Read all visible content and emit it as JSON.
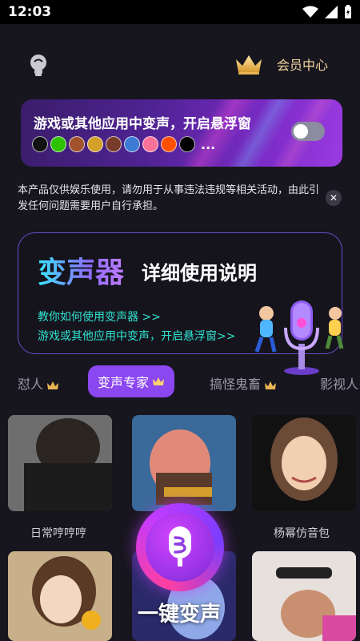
{
  "status": {
    "time": "12:03"
  },
  "header": {
    "vip_label": "会员中心",
    "colors": {
      "gold": "#f4d7a0"
    }
  },
  "float_card": {
    "title": "游戏或其他应用中变声，开启悬浮窗",
    "toggle_on": false,
    "more": "...",
    "app_icons": [
      "qq-icon",
      "wechat-icon",
      "game-icon-1",
      "game-icon-2",
      "game-icon-3",
      "game-icon-4",
      "bilibili-icon",
      "kuaishou-icon",
      "tiktok-icon"
    ]
  },
  "disclaimer": {
    "text": "本产品仅供娱乐使用，请勿用于从事违法违规等相关活动，由此引发任何问题需要用户自行承担。"
  },
  "guide": {
    "big": "变声器",
    "sub": "详细使用说明",
    "link1": "教你如何使用变声器 >>",
    "link2": "游戏或其他应用中变声，开启悬浮窗>>"
  },
  "tabs": [
    {
      "label": "怼人",
      "active": false
    },
    {
      "label": "变声专家",
      "active": true
    },
    {
      "label": "搞怪鬼畜",
      "active": false
    },
    {
      "label": "影视人",
      "active": false
    }
  ],
  "presets": [
    {
      "label": "日常哼哼哼"
    },
    {
      "label": ""
    },
    {
      "label": "杨幂仿音包"
    }
  ],
  "fab": {
    "label": "一键变声"
  }
}
